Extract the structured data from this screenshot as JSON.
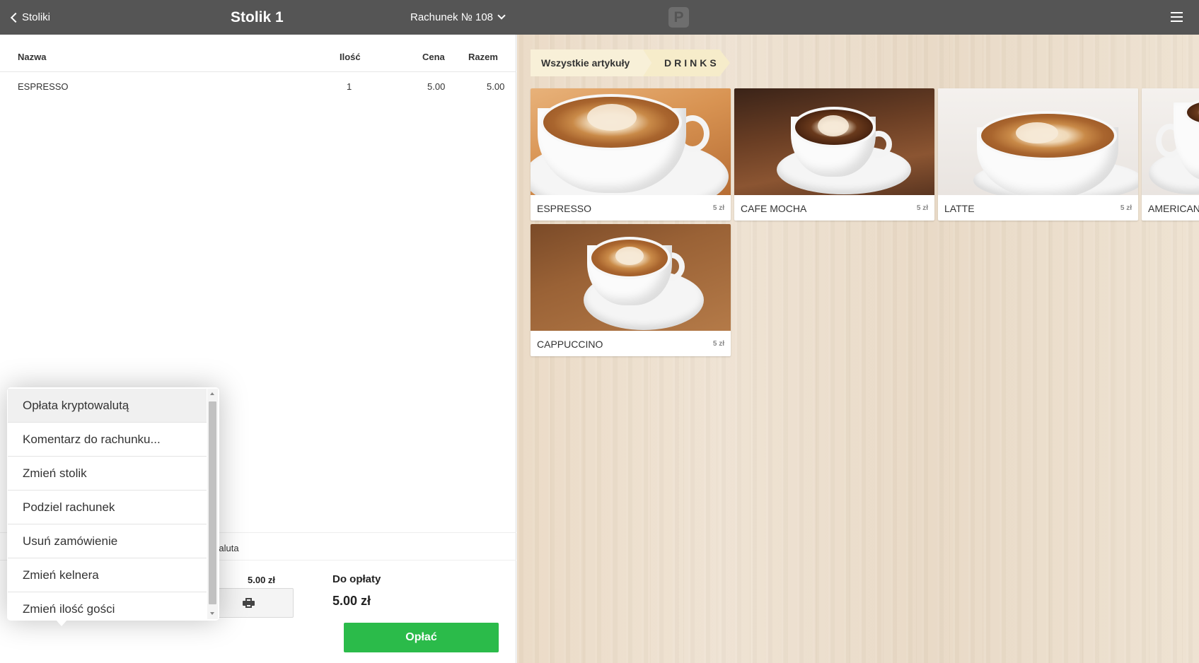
{
  "header": {
    "back_label": "Stoliki",
    "table_title": "Stolik 1",
    "bill_label": "Rachunek № 108",
    "logo_letter": "P"
  },
  "order": {
    "columns": {
      "name": "Nazwa",
      "qty": "Ilość",
      "price": "Cena",
      "total": "Razem"
    },
    "items": [
      {
        "name": "ESPRESSO",
        "qty": "1",
        "price": "5.00",
        "total": "5.00"
      }
    ],
    "note_visible": "waluta",
    "subtotal": "5.00 zł",
    "discount": "-",
    "due_label": "Do opłaty",
    "due_value": "5.00 zł"
  },
  "actions": {
    "percent_label": "%",
    "pay_label": "Opłać"
  },
  "popup_menu": {
    "items": [
      "Opłata kryptowalutą",
      "Komentarz do rachunku...",
      "Zmień stolik",
      "Podziel rachunek",
      "Usuń zamówienie",
      "Zmień kelnera",
      "Zmień ilość gości"
    ]
  },
  "catalog": {
    "breadcrumbs": [
      "Wszystkie artykuły",
      "DRINKS"
    ],
    "products": [
      {
        "name": "ESPRESSO",
        "price": "5 zł"
      },
      {
        "name": "CAFE MOCHA",
        "price": "5 zł"
      },
      {
        "name": "LATTE",
        "price": "5 zł"
      },
      {
        "name": "AMERICAN",
        "price": ""
      },
      {
        "name": "CAPPUCCINO",
        "price": "5 zł"
      }
    ]
  },
  "colors": {
    "topbar": "#555555",
    "pay_button": "#2bbb4a",
    "breadcrumb": "#f8f0d8"
  }
}
